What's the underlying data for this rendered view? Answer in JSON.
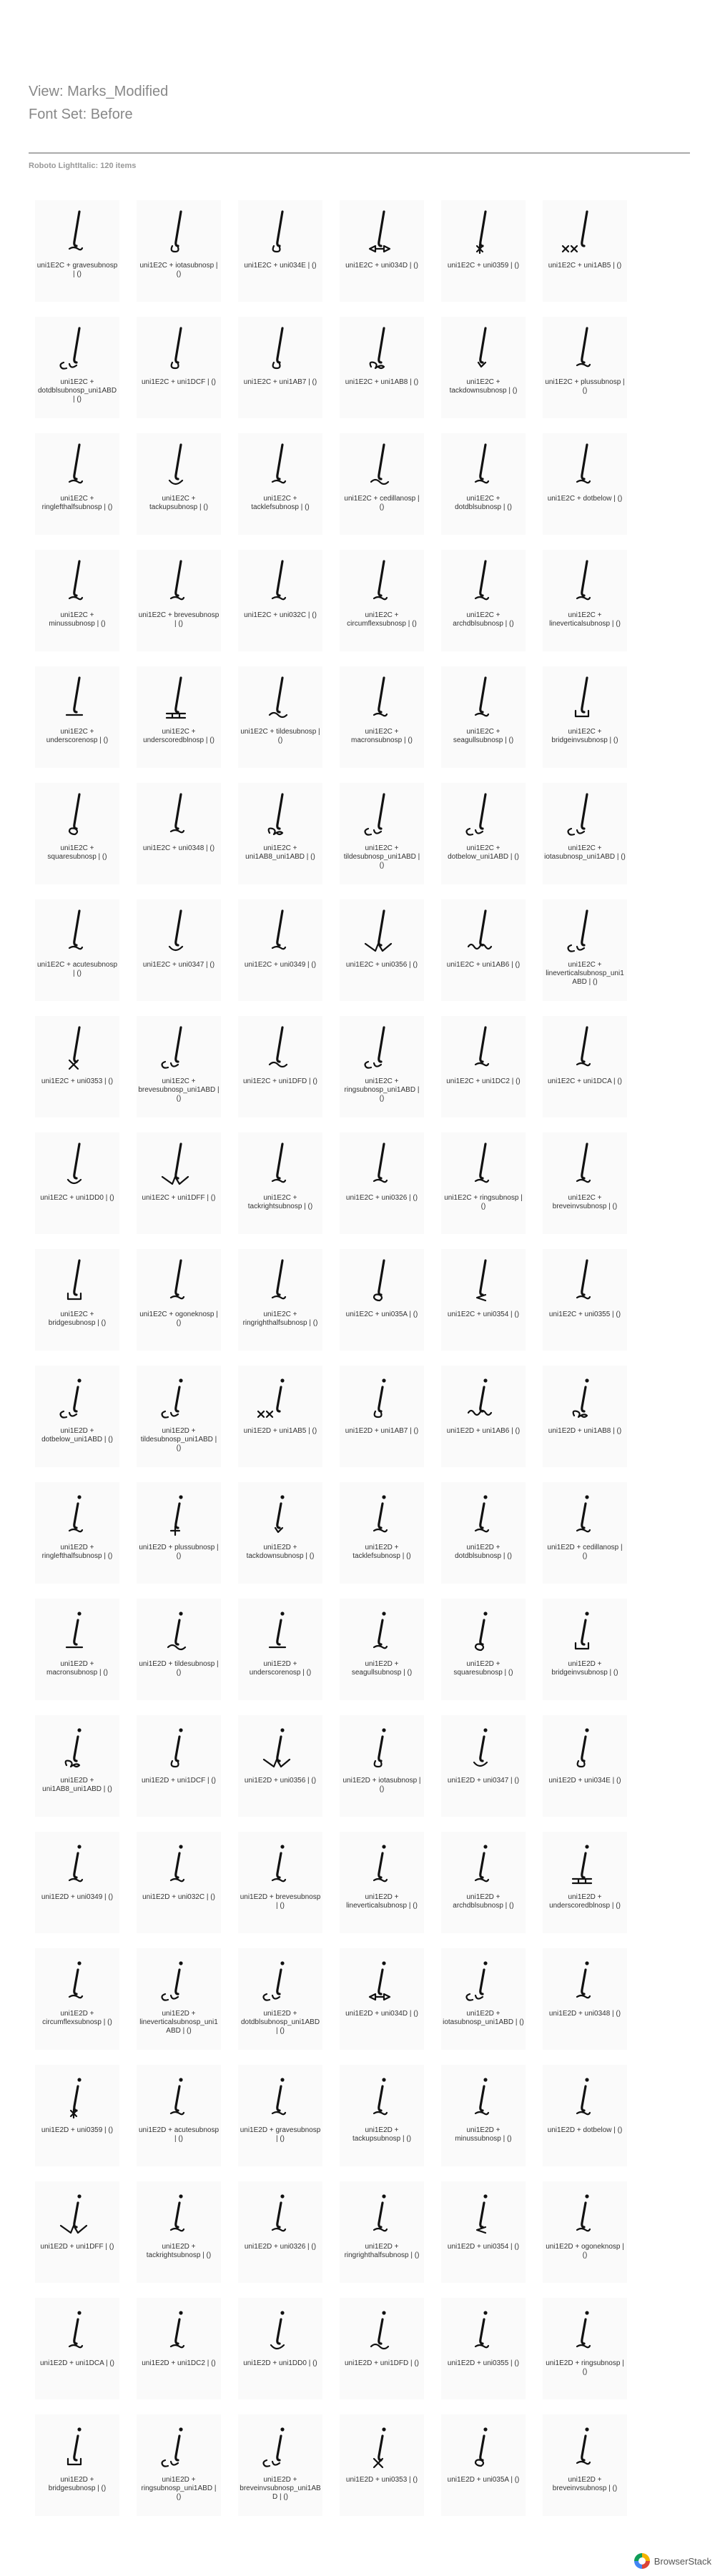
{
  "header": {
    "view_title": "View: Marks_Modified",
    "fontset_title": "Font Set: Before",
    "section_label": "Roboto LightItalic: 120 items"
  },
  "footer": {
    "brand": "BrowserStack"
  },
  "glyph_color": "#111111",
  "items": [
    {
      "label": "uni1E2C + gravesubnosp | ()",
      "mark": "curve"
    },
    {
      "label": "uni1E2C + iotasubnosp | ()",
      "mark": "hook"
    },
    {
      "label": "uni1E2C + uni034E | ()",
      "mark": "hook"
    },
    {
      "label": "uni1E2C + uni034D | ()",
      "mark": "arrows"
    },
    {
      "label": "uni1E2C + uni0359 | ()",
      "mark": "star"
    },
    {
      "label": "uni1E2C + uni1AB5 | ()",
      "mark": "crosses"
    },
    {
      "label": "uni1E2C + dotdblsubnosp_uni1ABD | ()",
      "mark": "cl"
    },
    {
      "label": "uni1E2C + uni1DCF | ()",
      "mark": "hook"
    },
    {
      "label": "uni1E2C + uni1AB7 | ()",
      "mark": "hook"
    },
    {
      "label": "uni1E2C + uni1AB8 | ()",
      "mark": "loops"
    },
    {
      "label": "uni1E2C + tackdownsubnosp | ()",
      "mark": "tick"
    },
    {
      "label": "uni1E2C + plussubnosp | ()",
      "mark": "curve"
    },
    {
      "label": "uni1E2C + ringlefthalfsubnosp | ()",
      "mark": "curve"
    },
    {
      "label": "uni1E2C + tackupsubnosp | ()",
      "mark": "thick"
    },
    {
      "label": "uni1E2C + tacklefsubnosp | ()",
      "mark": "curve"
    },
    {
      "label": "uni1E2C + cedillanosp | ()",
      "mark": "wave"
    },
    {
      "label": "uni1E2C + dotdblsubnosp | ()",
      "mark": "curve"
    },
    {
      "label": "uni1E2C + dotbelow | ()",
      "mark": "curve"
    },
    {
      "label": "uni1E2C + minussubnosp | ()",
      "mark": "curve"
    },
    {
      "label": "uni1E2C + brevesubnosp | ()",
      "mark": "curve"
    },
    {
      "label": "uni1E2C + uni032C | ()",
      "mark": "curve"
    },
    {
      "label": "uni1E2C + circumflexsubnosp | ()",
      "mark": "curve"
    },
    {
      "label": "uni1E2C + archdblsubnosp | ()",
      "mark": "curve"
    },
    {
      "label": "uni1E2C + lineverticalsubnosp | ()",
      "mark": "curve"
    },
    {
      "label": "uni1E2C + underscorenosp | ()",
      "mark": "bar"
    },
    {
      "label": "uni1E2C + underscoredblnosp | ()",
      "mark": "dblbar"
    },
    {
      "label": "uni1E2C + tildesubnosp | ()",
      "mark": "wave"
    },
    {
      "label": "uni1E2C + macronsubnosp | ()",
      "mark": "curve"
    },
    {
      "label": "uni1E2C + seagullsubnosp | ()",
      "mark": "curve"
    },
    {
      "label": "uni1E2C + bridgeinvsubnosp | ()",
      "mark": "box"
    },
    {
      "label": "uni1E2C + squaresubnosp | ()",
      "mark": "loop"
    },
    {
      "label": "uni1E2C + uni0348 | ()",
      "mark": "curve"
    },
    {
      "label": "uni1E2C + uni1AB8_uni1ABD | ()",
      "mark": "loops"
    },
    {
      "label": "uni1E2C + tildesubnosp_uni1ABD | ()",
      "mark": "cl"
    },
    {
      "label": "uni1E2C + dotbelow_uni1ABD | ()",
      "mark": "cl"
    },
    {
      "label": "uni1E2C + iotasubnosp_uni1ABD | ()",
      "mark": "cl"
    },
    {
      "label": "uni1E2C + acutesubnosp | ()",
      "mark": "curve"
    },
    {
      "label": "uni1E2C + uni0347 | ()",
      "mark": "thick"
    },
    {
      "label": "uni1E2C + uni0349 | ()",
      "mark": "curve"
    },
    {
      "label": "uni1E2C + uni0356 | ()",
      "mark": "arrowr"
    },
    {
      "label": "uni1E2C + uni1AB6 | ()",
      "mark": "zig"
    },
    {
      "label": "uni1E2C + lineverticalsubnosp_uni1ABD | ()",
      "mark": "cl"
    },
    {
      "label": "uni1E2C + uni0353 | ()",
      "mark": "x"
    },
    {
      "label": "uni1E2C + brevesubnosp_uni1ABD | ()",
      "mark": "cl"
    },
    {
      "label": "uni1E2C + uni1DFD | ()",
      "mark": "wave"
    },
    {
      "label": "uni1E2C + ringsubnosp_uni1ABD | ()",
      "mark": "cl"
    },
    {
      "label": "uni1E2C + uni1DC2 | ()",
      "mark": "curve"
    },
    {
      "label": "uni1E2C + uni1DCA | ()",
      "mark": "curve"
    },
    {
      "label": "uni1E2C + uni1DD0 | ()",
      "mark": "thick"
    },
    {
      "label": "uni1E2C + uni1DFF | ()",
      "mark": "arrowr"
    },
    {
      "label": "uni1E2C + tackrightsubnosp | ()",
      "mark": "curve"
    },
    {
      "label": "uni1E2C + uni0326 | ()",
      "mark": "curve"
    },
    {
      "label": "uni1E2C + ringsubnosp | ()",
      "mark": "curve"
    },
    {
      "label": "uni1E2C + breveinvsubnosp | ()",
      "mark": "curve"
    },
    {
      "label": "uni1E2C + bridgesubnosp | ()",
      "mark": "box"
    },
    {
      "label": "uni1E2C + ogoneknosp | ()",
      "mark": "curve"
    },
    {
      "label": "uni1E2C + ringrighthalfsubnosp | ()",
      "mark": "curve"
    },
    {
      "label": "uni1E2C + uni035A | ()",
      "mark": "loop"
    },
    {
      "label": "uni1E2C + uni0354 | ()",
      "mark": "arrowl"
    },
    {
      "label": "uni1E2C + uni0355 | ()",
      "mark": "curve"
    },
    {
      "label": "uni1E2D + dotbelow_uni1ABD | ()",
      "mark": "cl"
    },
    {
      "label": "uni1E2D + tildesubnosp_uni1ABD | ()",
      "mark": "cl"
    },
    {
      "label": "uni1E2D + uni1AB5 | ()",
      "mark": "crosses"
    },
    {
      "label": "uni1E2D + uni1AB7 | ()",
      "mark": "hook"
    },
    {
      "label": "uni1E2D + uni1AB6 | ()",
      "mark": "zig"
    },
    {
      "label": "uni1E2D + uni1AB8 | ()",
      "mark": "loops"
    },
    {
      "label": "uni1E2D + ringlefthalfsubnosp | ()",
      "mark": "curve"
    },
    {
      "label": "uni1E2D + plussubnosp | ()",
      "mark": "plus"
    },
    {
      "label": "uni1E2D + tackdownsubnosp | ()",
      "mark": "tick"
    },
    {
      "label": "uni1E2D + tacklefsubnosp | ()",
      "mark": "curve"
    },
    {
      "label": "uni1E2D + dotdblsubnosp | ()",
      "mark": "curve"
    },
    {
      "label": "uni1E2D + cedillanosp | ()",
      "mark": "curve"
    },
    {
      "label": "uni1E2D + macronsubnosp | ()",
      "mark": "bar"
    },
    {
      "label": "uni1E2D + tildesubnosp | ()",
      "mark": "wave"
    },
    {
      "label": "uni1E2D + underscorenosp | ()",
      "mark": "bar"
    },
    {
      "label": "uni1E2D + seagullsubnosp | ()",
      "mark": "curve"
    },
    {
      "label": "uni1E2D + squaresubnosp | ()",
      "mark": "loop"
    },
    {
      "label": "uni1E2D + bridgeinvsubnosp | ()",
      "mark": "box"
    },
    {
      "label": "uni1E2D + uni1AB8_uni1ABD | ()",
      "mark": "loops"
    },
    {
      "label": "uni1E2D + uni1DCF | ()",
      "mark": "hook"
    },
    {
      "label": "uni1E2D + uni0356 | ()",
      "mark": "arrowr"
    },
    {
      "label": "uni1E2D + iotasubnosp | ()",
      "mark": "hook"
    },
    {
      "label": "uni1E2D + uni0347 | ()",
      "mark": "thick"
    },
    {
      "label": "uni1E2D + uni034E | ()",
      "mark": "hook"
    },
    {
      "label": "uni1E2D + uni0349 | ()",
      "mark": "curve"
    },
    {
      "label": "uni1E2D + uni032C | ()",
      "mark": "curve"
    },
    {
      "label": "uni1E2D + brevesubnosp | ()",
      "mark": "curve"
    },
    {
      "label": "uni1E2D + lineverticalsubnosp | ()",
      "mark": "curve"
    },
    {
      "label": "uni1E2D + archdblsubnosp | ()",
      "mark": "curve"
    },
    {
      "label": "uni1E2D + underscoredblnosp | ()",
      "mark": "dblbar"
    },
    {
      "label": "uni1E2D + circumflexsubnosp | ()",
      "mark": "curve"
    },
    {
      "label": "uni1E2D + lineverticalsubnosp_uni1ABD | ()",
      "mark": "cl"
    },
    {
      "label": "uni1E2D + dotdblsubnosp_uni1ABD | ()",
      "mark": "cl"
    },
    {
      "label": "uni1E2D + uni034D | ()",
      "mark": "arrows"
    },
    {
      "label": "uni1E2D + iotasubnosp_uni1ABD | ()",
      "mark": "cl"
    },
    {
      "label": "uni1E2D + uni0348 | ()",
      "mark": "curve"
    },
    {
      "label": "uni1E2D + uni0359 | ()",
      "mark": "star"
    },
    {
      "label": "uni1E2D + acutesubnosp | ()",
      "mark": "curve"
    },
    {
      "label": "uni1E2D + gravesubnosp | ()",
      "mark": "curve"
    },
    {
      "label": "uni1E2D + tackupsubnosp | ()",
      "mark": "curve"
    },
    {
      "label": "uni1E2D + minussubnosp | ()",
      "mark": "curve"
    },
    {
      "label": "uni1E2D + dotbelow | ()",
      "mark": "curve"
    },
    {
      "label": "uni1E2D + uni1DFF | ()",
      "mark": "arrowr"
    },
    {
      "label": "uni1E2D + tackrightsubnosp | ()",
      "mark": "curve"
    },
    {
      "label": "uni1E2D + uni0326 | ()",
      "mark": "curve"
    },
    {
      "label": "uni1E2D + ringrighthalfsubnosp | ()",
      "mark": "curve"
    },
    {
      "label": "uni1E2D + uni0354 | ()",
      "mark": "arrowl"
    },
    {
      "label": "uni1E2D + ogoneknosp | ()",
      "mark": "curve"
    },
    {
      "label": "uni1E2D + uni1DCA | ()",
      "mark": "curve"
    },
    {
      "label": "uni1E2D + uni1DC2 | ()",
      "mark": "curve"
    },
    {
      "label": "uni1E2D + uni1DD0 | ()",
      "mark": "thick"
    },
    {
      "label": "uni1E2D + uni1DFD | ()",
      "mark": "wave"
    },
    {
      "label": "uni1E2D + uni0355 | ()",
      "mark": "curve"
    },
    {
      "label": "uni1E2D + ringsubnosp | ()",
      "mark": "curve"
    },
    {
      "label": "uni1E2D + bridgesubnosp | ()",
      "mark": "box"
    },
    {
      "label": "uni1E2D + ringsubnosp_uni1ABD | ()",
      "mark": "cl"
    },
    {
      "label": "uni1E2D + breveinvsubnosp_uni1ABD | ()",
      "mark": "cl"
    },
    {
      "label": "uni1E2D + uni0353 | ()",
      "mark": "x"
    },
    {
      "label": "uni1E2D + uni035A | ()",
      "mark": "loop"
    },
    {
      "label": "uni1E2D + breveinvsubnosp | ()",
      "mark": "curve"
    }
  ]
}
